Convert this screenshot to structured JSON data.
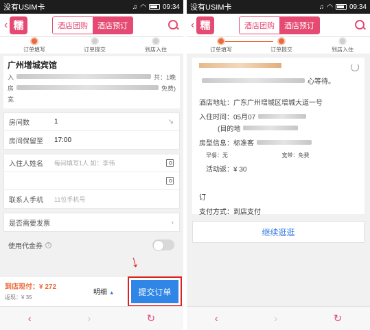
{
  "status": {
    "carrier": "没有USIM卡",
    "time": "09:34"
  },
  "header": {
    "logo": "糯",
    "tab_group": "酒店团购",
    "tab_booking": "酒店预订"
  },
  "steps": [
    "订单填写",
    "订单提交",
    "到店入住"
  ],
  "left": {
    "hotel_name": "广州增城宾馆",
    "line1_prefix": "入",
    "line1_suffix": "共：1晚",
    "line2_prefix": "房",
    "line2_suffix": "免费)",
    "line3_prefix": "宽",
    "rooms_label": "房间数",
    "rooms_value": "1",
    "hold_label": "房间保留至",
    "hold_value": "17:00",
    "guest_label": "入住人姓名",
    "guest_placeholder": "每间填写1人 如：李伟",
    "phone_label": "联系人手机",
    "phone_placeholder": "11位手机号",
    "invoice_label": "是否需要发票",
    "voucher_label": "使用代金券",
    "pay_amount": "到店现付：¥ 272",
    "rebate": "返现：¥ 35",
    "detail": "明细",
    "submit": "提交订单"
  },
  "right": {
    "line_wait": "心等待。",
    "address": "酒店地址：广东广州增城区增城大道一号",
    "checkin": "入住时间：05月07",
    "checkin_sub": "(目的地",
    "roomtype": "房型信息：标准客",
    "breakfast": "早餐：无",
    "broadband": "宽带：免费",
    "activity": "活动返：¥ 30",
    "order_prefix": "订",
    "pay_method": "支付方式：到店支付",
    "continue": "继续逛逛"
  },
  "nav": {
    "back": "‹",
    "forward": "›",
    "refresh": "↻"
  },
  "colors": {
    "brand": "#e54a72",
    "submit": "#2f86e6",
    "price": "#e96a3a",
    "annotation": "#e02020"
  }
}
